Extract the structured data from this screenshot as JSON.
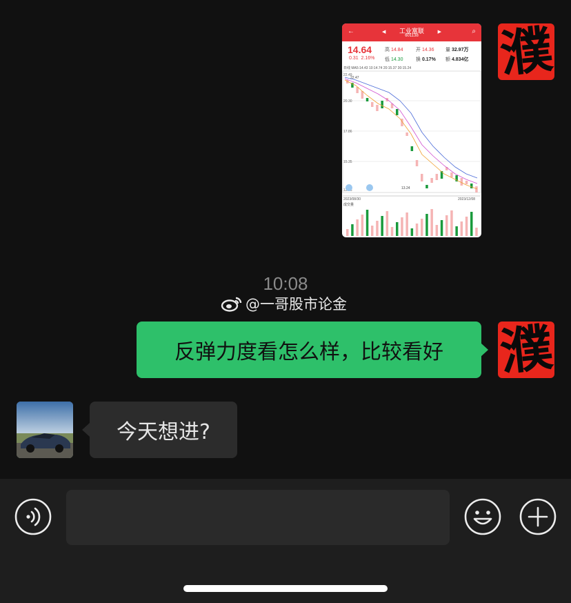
{
  "avatars": {
    "me_glyph": "濮",
    "me_color": "#e8261c"
  },
  "stock_card": {
    "name": "工业富联",
    "code": "601138",
    "price": "14.64",
    "change": "0.31",
    "change_pct": "2.16%",
    "high_label": "高",
    "high": "14.84",
    "open_label": "开",
    "open": "14.36",
    "volume_label": "量",
    "volume": "32.97万",
    "low_label": "低",
    "low": "14.30",
    "turnover_label": "换",
    "turnover": "0.17%",
    "amount_label": "额",
    "amount": "4.834亿",
    "ma_line": "日线  MA5:14.43  10:14.74  20:15.37  30:15.24",
    "date_start": "2023/08/30",
    "date_end": "2023/12/08",
    "low_mark": "13.24",
    "volume_panel_label": "成交量",
    "y_ticks": [
      "22.49",
      "20.30",
      "17.86",
      "15.35",
      "12.86"
    ],
    "top_mark": "22.47",
    "up_color": "#e7343a",
    "down_color": "#1a9a3c"
  },
  "chat": {
    "time": "10:08",
    "watermark": "@一哥股市论金",
    "message_me": "反弹力度看怎么样，比较看好",
    "message_friend": "今天想进?",
    "me_bubble_color": "#2ec06a"
  },
  "toolbar": {
    "voice_icon": "voice-icon",
    "emoji_icon": "emoji-icon",
    "plus_icon": "plus-icon"
  }
}
